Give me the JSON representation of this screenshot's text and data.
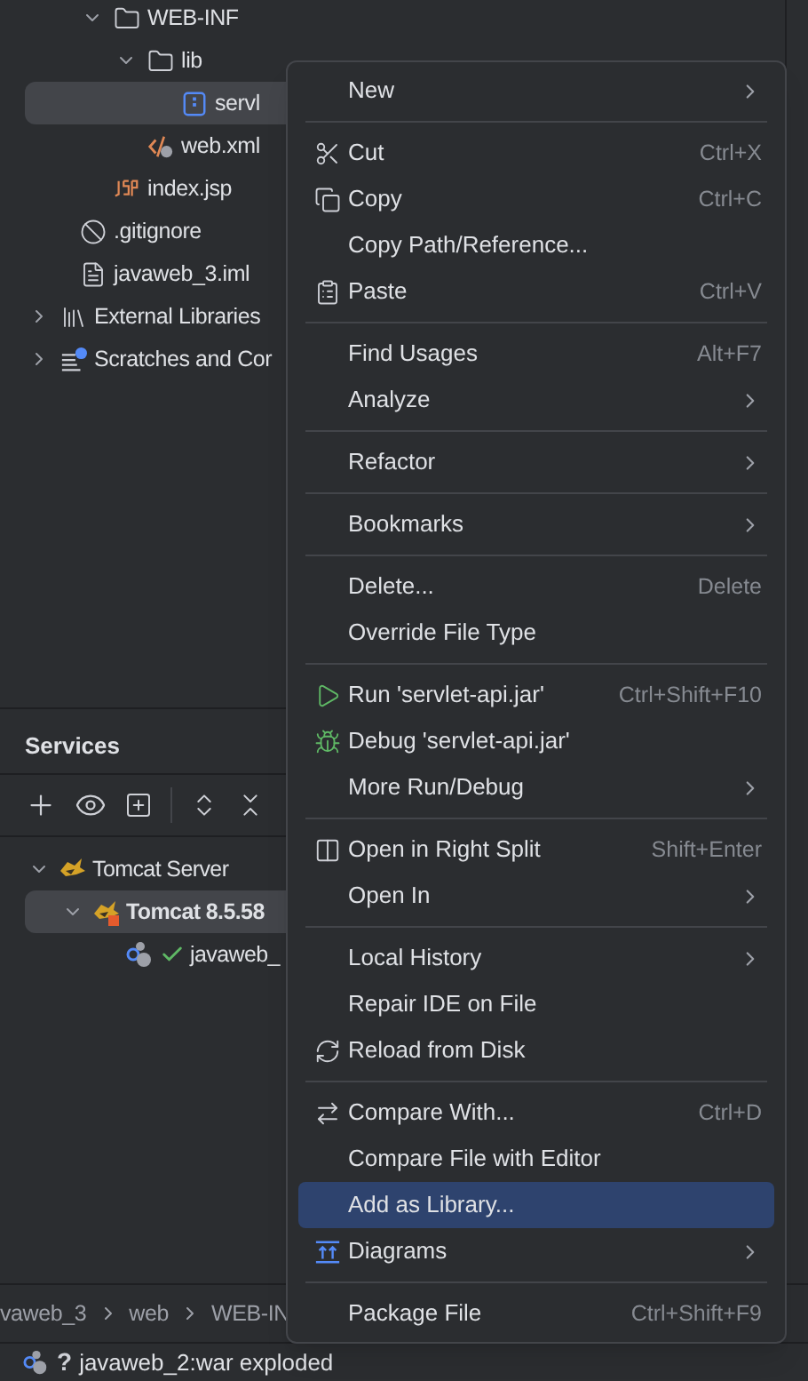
{
  "project_tree": {
    "items": [
      {
        "kind": "offscreen",
        "children": [
          {
            "kind": "offscreen",
            "children": [
              {
                "kind": "folder",
                "label": "WEB-INF",
                "expanded": true,
                "selected": false,
                "children": [
                  {
                    "kind": "folder",
                    "label": "lib",
                    "expanded": true,
                    "selected": false,
                    "children": [
                      {
                        "kind": "jar",
                        "label": "servl",
                        "selected": true
                      }
                    ]
                  },
                  {
                    "kind": "xml",
                    "label": "web.xml",
                    "selected": false
                  }
                ]
              },
              {
                "kind": "jsp",
                "label": "index.jsp",
                "selected": false
              }
            ]
          },
          {
            "kind": "ignore",
            "label": ".gitignore",
            "selected": false
          },
          {
            "kind": "file",
            "label": "javaweb_3.iml",
            "selected": false
          }
        ]
      },
      {
        "kind": "libraries",
        "label": "External Libraries",
        "expanded": false,
        "selected": false
      },
      {
        "kind": "scratches",
        "label": "Scratches and Cor",
        "expanded": false,
        "selected": false
      }
    ]
  },
  "services": {
    "title": "Services",
    "items": [
      {
        "kind": "tomcat",
        "label": "Tomcat Server",
        "expanded": true,
        "selected": false,
        "children": [
          {
            "kind": "tomcat-stopped",
            "label": "Tomcat 8.5.58",
            "expanded": true,
            "selected": true,
            "children": [
              {
                "kind": "artifact",
                "label": "javaweb_",
                "deployed": true,
                "selected": false
              }
            ]
          }
        ]
      }
    ]
  },
  "breadcrumbs": [
    "vaweb_3",
    "web",
    "WEB-IN"
  ],
  "status_bar": {
    "text": "javaweb_2:war exploded",
    "marker": "?"
  },
  "context_menu": {
    "groups": [
      [
        {
          "label": "New",
          "submenu": true,
          "selected": false
        }
      ],
      [
        {
          "label": "Cut",
          "kind": "cut",
          "shortcut": "Ctrl+X",
          "submenu": false,
          "selected": false
        },
        {
          "label": "Copy",
          "kind": "copy",
          "shortcut": "Ctrl+C",
          "submenu": false,
          "selected": false
        },
        {
          "label": "Copy Path/Reference...",
          "submenu": false,
          "selected": false
        },
        {
          "label": "Paste",
          "kind": "paste",
          "shortcut": "Ctrl+V",
          "submenu": false,
          "selected": false
        }
      ],
      [
        {
          "label": "Find Usages",
          "shortcut": "Alt+F7",
          "submenu": false,
          "selected": false
        },
        {
          "label": "Analyze",
          "submenu": true,
          "selected": false
        }
      ],
      [
        {
          "label": "Refactor",
          "submenu": true,
          "selected": false
        }
      ],
      [
        {
          "label": "Bookmarks",
          "submenu": true,
          "selected": false
        }
      ],
      [
        {
          "label": "Delete...",
          "shortcut": "Delete",
          "submenu": false,
          "selected": false
        },
        {
          "label": "Override File Type",
          "submenu": false,
          "selected": false
        }
      ],
      [
        {
          "label": "Run 'servlet-api.jar'",
          "kind": "run",
          "shortcut": "Ctrl+Shift+F10",
          "submenu": false,
          "selected": false
        },
        {
          "label": "Debug 'servlet-api.jar'",
          "kind": "debug",
          "submenu": false,
          "selected": false
        },
        {
          "label": "More Run/Debug",
          "submenu": true,
          "selected": false
        }
      ],
      [
        {
          "label": "Open in Right Split",
          "kind": "split",
          "shortcut": "Shift+Enter",
          "submenu": false,
          "selected": false
        },
        {
          "label": "Open In",
          "submenu": true,
          "selected": false
        }
      ],
      [
        {
          "label": "Local History",
          "submenu": true,
          "selected": false
        },
        {
          "label": "Repair IDE on File",
          "submenu": false,
          "selected": false
        },
        {
          "label": "Reload from Disk",
          "kind": "reload",
          "submenu": false,
          "selected": false
        }
      ],
      [
        {
          "label": "Compare With...",
          "kind": "compare",
          "shortcut": "Ctrl+D",
          "submenu": false,
          "selected": false
        },
        {
          "label": "Compare File with Editor",
          "submenu": false,
          "selected": false
        },
        {
          "label": "Add as Library...",
          "submenu": false,
          "selected": true
        },
        {
          "label": "Diagrams",
          "kind": "diagrams",
          "submenu": true,
          "selected": false
        }
      ],
      [
        {
          "label": "Package File",
          "shortcut": "Ctrl+Shift+F9",
          "submenu": false,
          "selected": false
        }
      ]
    ]
  }
}
